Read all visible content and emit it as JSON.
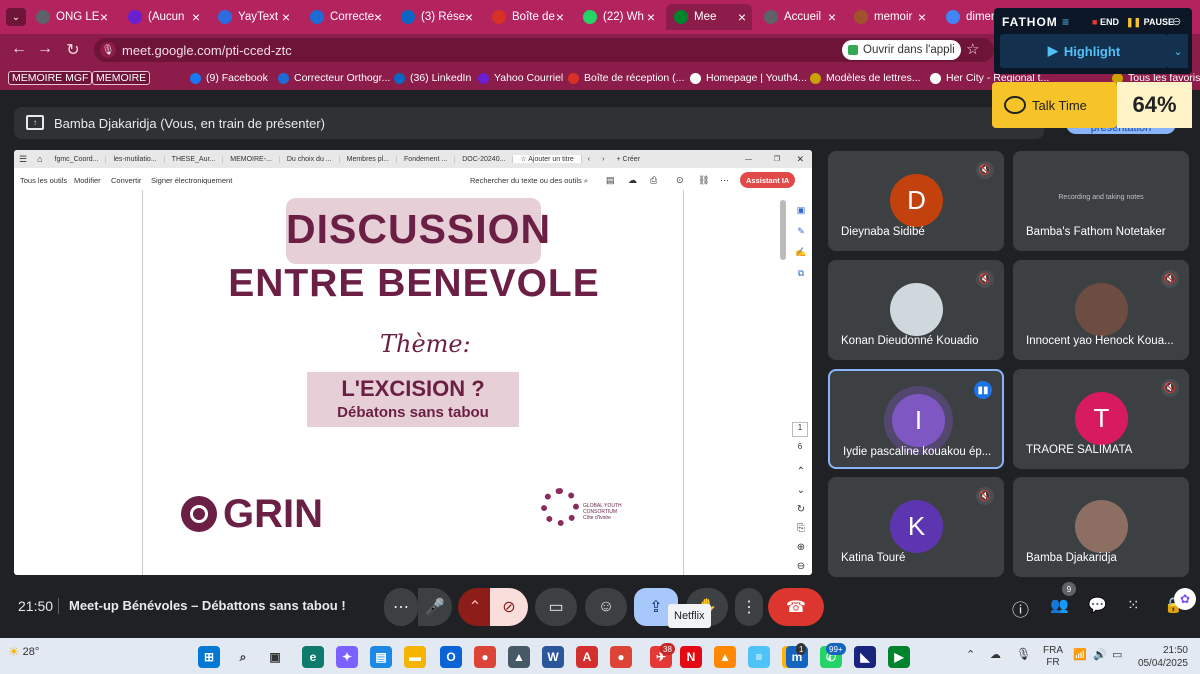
{
  "tabs": [
    {
      "title": "ONG LE",
      "color": "#5f6368"
    },
    {
      "title": "(Aucun",
      "color": "#6a1fd0"
    },
    {
      "title": "YayText",
      "color": "#2d6cdf"
    },
    {
      "title": "Correcte",
      "color": "#1f6bd6"
    },
    {
      "title": "(3) Rése",
      "color": "#0a66c2"
    },
    {
      "title": "Boîte de",
      "color": "#d93025"
    },
    {
      "title": "(22) Wh",
      "color": "#25d366"
    },
    {
      "title": "Mee",
      "color": "#00832d"
    },
    {
      "title": "Accueil",
      "color": "#5f6368"
    },
    {
      "title": "memoir",
      "color": "#a0522d"
    },
    {
      "title": "dimens",
      "color": "#4285f4"
    }
  ],
  "address": {
    "url": "meet.google.com/pti-cced-ztc",
    "open_app": "Ouvrir dans l'appli"
  },
  "bookmarks": [
    {
      "label": "MEMOIRE MGF",
      "chip": true
    },
    {
      "label": "MEMOIRE",
      "chip": true
    },
    {
      "label": "(9) Facebook",
      "color": "#1877f2"
    },
    {
      "label": "Correcteur Orthogr...",
      "color": "#1f6bd6"
    },
    {
      "label": "(36) LinkedIn",
      "color": "#0a66c2"
    },
    {
      "label": "Yahoo Courriel",
      "color": "#6a1fd0"
    },
    {
      "label": "Boîte de réception (...",
      "color": "#d93025"
    },
    {
      "label": "Homepage | Youth4...",
      "color": "#ffffff"
    },
    {
      "label": "Modèles de lettres...",
      "color": "#c9a100"
    },
    {
      "label": "Her City - Regional t...",
      "color": "#ffffff"
    },
    {
      "label": "Tous les favoris",
      "color": "#c9a100"
    }
  ],
  "fathom": {
    "brand": "FATHOM",
    "end": "END",
    "pause": "PAUSE",
    "highlight": "Highlight",
    "talk": "Talk Time",
    "pct": "64%"
  },
  "presenter": {
    "label": "Bamba Djakaridja (Vous, en train de présenter)",
    "side_label": "présentation"
  },
  "pdf": {
    "tabs": [
      "fgmc_Coord...",
      "les-mutilatio...",
      "THESE_Aur...",
      "MEMOIRE-...",
      "Du choix du ...",
      "Membres pl...",
      "Fondement ...",
      "DOC-20240..."
    ],
    "add_title": "Ajouter un titre",
    "create": "Créer",
    "tools": [
      "Tous les outils",
      "Modifier",
      "Convertir",
      "Signer électroniquement"
    ],
    "search": "Rechercher du texte ou des outils",
    "ai": "Assistant IA",
    "page_current": "1",
    "page_total": "6"
  },
  "slide": {
    "title1": "DISCUSSION",
    "title2": "ENTRE BENEVOLE",
    "theme": "Thème:",
    "q1": "L'EXCISION ?",
    "q2": "Débatons sans tabou",
    "logo1": "GRIN",
    "logo2_l1": "GLOBAL YOUTH",
    "logo2_l2": "CONSORTIUM",
    "logo2_l3": "Côte d'Ivoire"
  },
  "participants": [
    {
      "name": "Dieynaba Sidibé",
      "initial": "D",
      "color": "#c2410c",
      "muted": true
    },
    {
      "name": "Bamba's Fathom Notetaker",
      "initial": "",
      "color": "",
      "muted": false,
      "note": "Recording and taking notes"
    },
    {
      "name": "Konan Dieudonné Kouadio",
      "initial": "",
      "color": "#cfd8dc",
      "muted": true
    },
    {
      "name": "Innocent yao Henock Koua...",
      "initial": "",
      "color": "#6d4c41",
      "muted": true
    },
    {
      "name": "Iydie pascaline kouakou ép...",
      "initial": "I",
      "color": "#7e57c2",
      "muted": false,
      "speaking": true
    },
    {
      "name": "TRAORE SALIMATA",
      "initial": "T",
      "color": "#d81b60",
      "muted": true
    },
    {
      "name": "Katina Touré",
      "initial": "K",
      "color": "#5e35b1",
      "muted": true
    },
    {
      "name": "Bamba Djakaridja",
      "initial": "",
      "color": "#8d6e63",
      "muted": false
    }
  ],
  "meeting": {
    "time": "21:50",
    "title": "Meet-up Bénévoles – Débattons sans tabou !",
    "tooltip": "Netflix",
    "people_count": "9"
  },
  "taskbar": {
    "weather": "28°",
    "lang1": "FRA",
    "lang2": "FR",
    "time": "21:50",
    "date": "05/04/2025",
    "badges": {
      "tg": "38",
      "ms": "1",
      "wa": "99+"
    }
  }
}
